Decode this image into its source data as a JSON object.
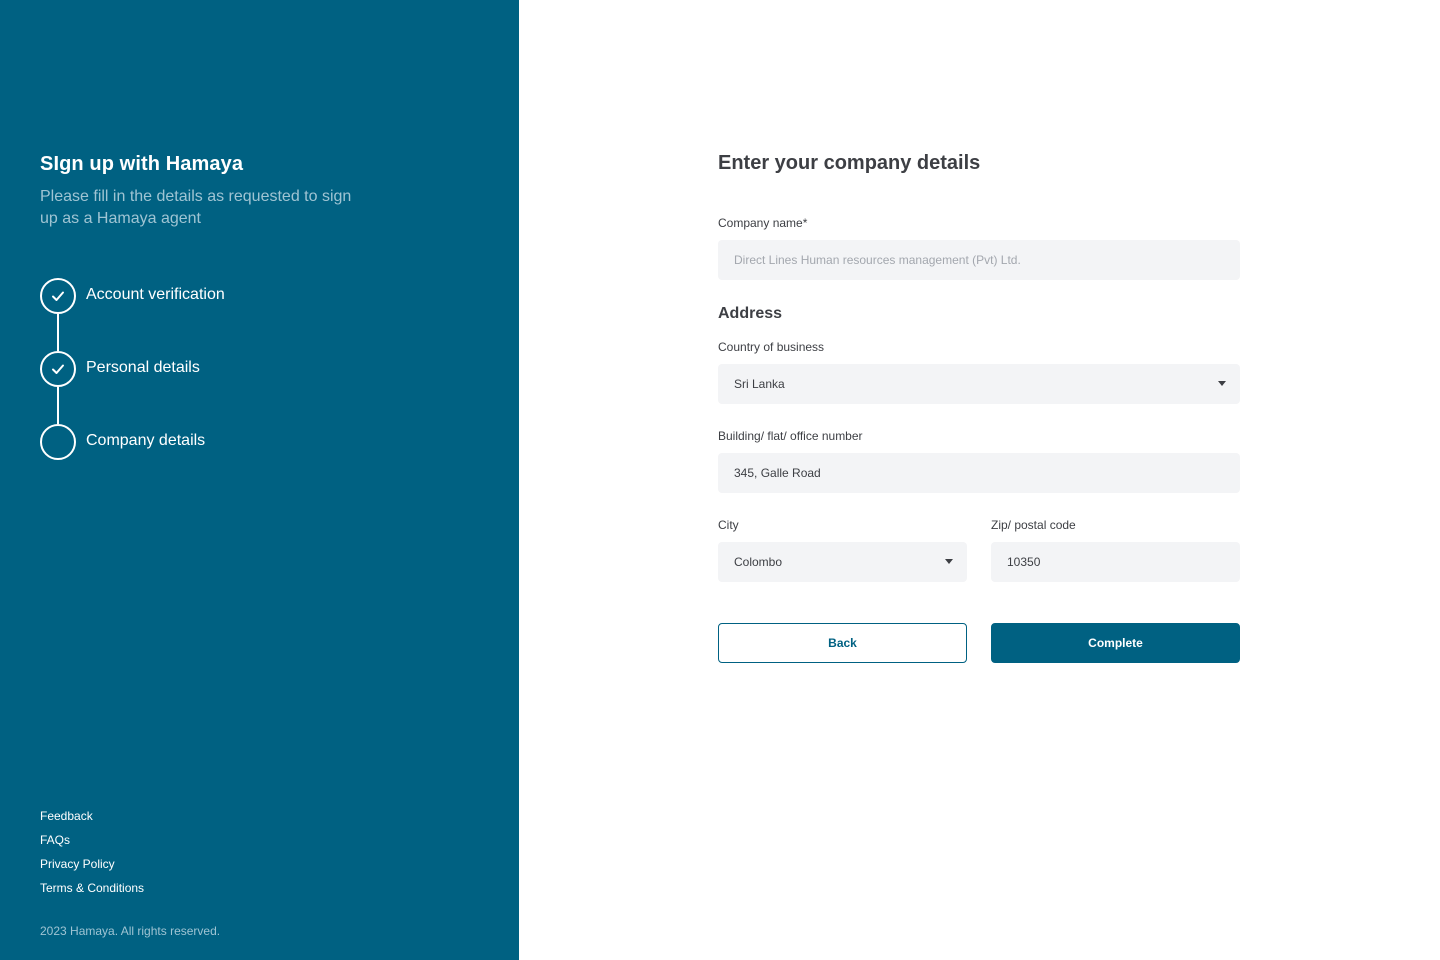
{
  "sidebar": {
    "title": "SIgn up with Hamaya",
    "subtitle": "Please fill in the details as requested to sign up as a Hamaya agent",
    "steps": [
      {
        "label": "Account verification",
        "status": "completed",
        "icon": "check-icon"
      },
      {
        "label": "Personal details",
        "status": "completed",
        "icon": "check-icon"
      },
      {
        "label": "Company details",
        "status": "current",
        "icon": "empty-circle"
      }
    ],
    "footer_links": [
      "Feedback",
      "FAQs",
      "Privacy Policy",
      "Terms & Conditions"
    ],
    "copyright": "2023 Hamaya. All rights reserved."
  },
  "form": {
    "heading": "Enter your company details",
    "company_name": {
      "label": "Company name*",
      "value": "",
      "placeholder": "Direct Lines Human resources management (Pvt) Ltd."
    },
    "address_heading": "Address",
    "country": {
      "label": "Country of business",
      "value": "Sri Lanka"
    },
    "building": {
      "label": "Building/ flat/ office number",
      "value": "345, Galle Road"
    },
    "city": {
      "label": "City",
      "value": "Colombo"
    },
    "zip": {
      "label": "Zip/ postal code",
      "value": "10350"
    },
    "back_label": "Back",
    "complete_label": "Complete"
  },
  "colors": {
    "brand": "#006182",
    "field_bg": "#f3f4f6",
    "text": "#3d3f44"
  }
}
